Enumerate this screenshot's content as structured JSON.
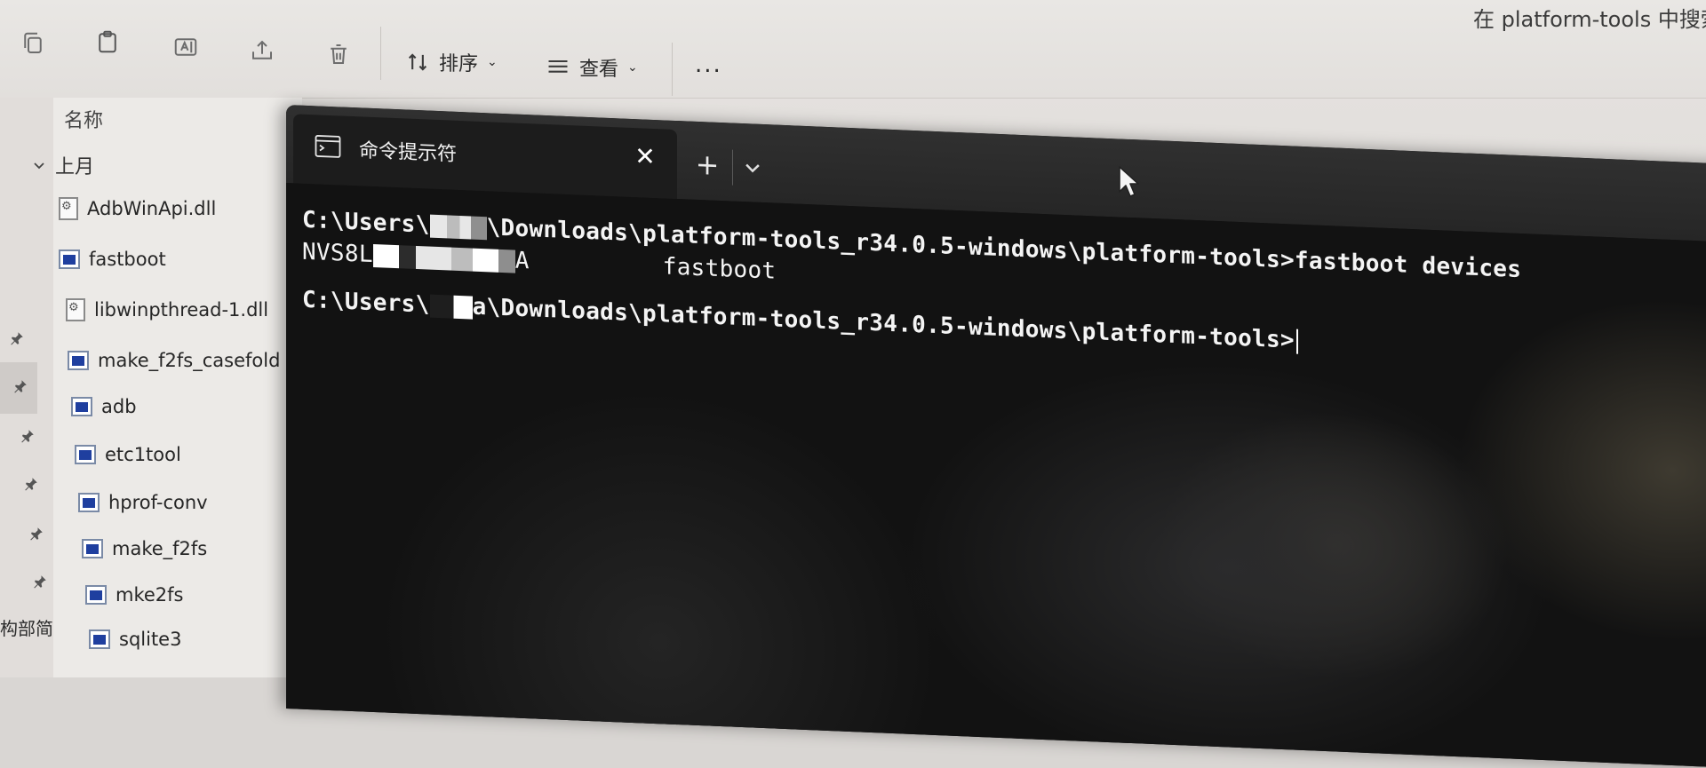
{
  "toolbar": {
    "copy_icon": "copy-icon",
    "paste_icon": "paste-icon",
    "rename_icon": "rename-icon",
    "share_icon": "share-icon",
    "delete_icon": "delete-icon",
    "sort_label": "排序",
    "view_label": "查看",
    "more_label": "...",
    "search_hint": "在 platform-tools 中搜索"
  },
  "explorer": {
    "column_name": "名称",
    "group_label": "上月",
    "sidebar_cut_text": "构部简",
    "files": [
      {
        "name": "AdbWinApi.dll",
        "icon": "dll-icon"
      },
      {
        "name": "fastboot",
        "icon": "exe-icon"
      },
      {
        "name": "libwinpthread-1.dll",
        "icon": "dll-icon"
      },
      {
        "name": "make_f2fs_casefold",
        "icon": "exe-icon"
      },
      {
        "name": "adb",
        "icon": "exe-icon"
      },
      {
        "name": "etc1tool",
        "icon": "exe-icon"
      },
      {
        "name": "hprof-conv",
        "icon": "exe-icon"
      },
      {
        "name": "make_f2fs",
        "icon": "exe-icon"
      },
      {
        "name": "mke2fs",
        "icon": "exe-icon"
      },
      {
        "name": "sqlite3",
        "icon": "exe-icon"
      }
    ]
  },
  "terminal": {
    "tab_title": "命令提示符",
    "close_label": "✕",
    "new_tab_label": "+",
    "line1_prefix": "C:\\Users\\",
    "line1_suffix": "\\Downloads\\platform-tools_r34.0.5-windows\\platform-tools>fastboot devices",
    "line2_prefix": "NVS8L",
    "line2_suffix": "A",
    "line2_mode": "fastboot",
    "line3_prefix": "C:\\Users\\",
    "line3_suffix": "a\\Downloads\\platform-tools_r34.0.5-windows\\platform-tools>"
  }
}
